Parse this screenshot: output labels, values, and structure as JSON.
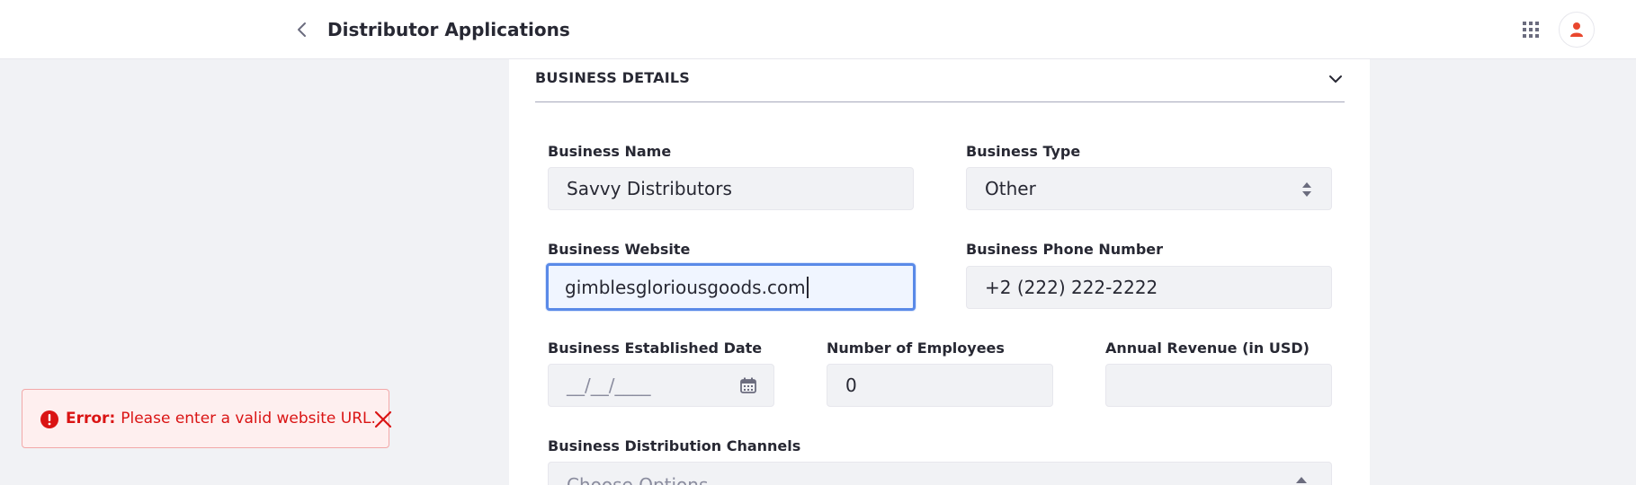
{
  "header": {
    "title": "Distributor Applications",
    "back_icon": "chevron-left-icon",
    "apps_icon": "apps-grid-icon",
    "avatar_icon": "user-icon"
  },
  "section": {
    "title": "BUSINESS DETAILS",
    "toggle_icon": "chevron-down-icon"
  },
  "form": {
    "business_name": {
      "label": "Business Name",
      "value": "Savvy Distributors"
    },
    "business_type": {
      "label": "Business Type",
      "value": "Other"
    },
    "business_website": {
      "label": "Business Website",
      "value": "gimblesgloriousgoods.com"
    },
    "business_phone": {
      "label": "Business Phone Number",
      "value": "+2 (222) 222-2222"
    },
    "established_date": {
      "label": "Business Established Date",
      "placeholder": "__/__/____"
    },
    "employees": {
      "label": "Number of Employees",
      "value": "0"
    },
    "annual_revenue": {
      "label": "Annual Revenue (in USD)",
      "value": ""
    },
    "distribution_channels": {
      "label": "Business Distribution Channels",
      "placeholder": "Choose Options"
    }
  },
  "toast": {
    "prefix": "Error:",
    "message": "Please enter a valid website URL."
  },
  "colors": {
    "error": "#da1414",
    "focus": "#5a8ae8",
    "avatar": "#e9472e"
  }
}
